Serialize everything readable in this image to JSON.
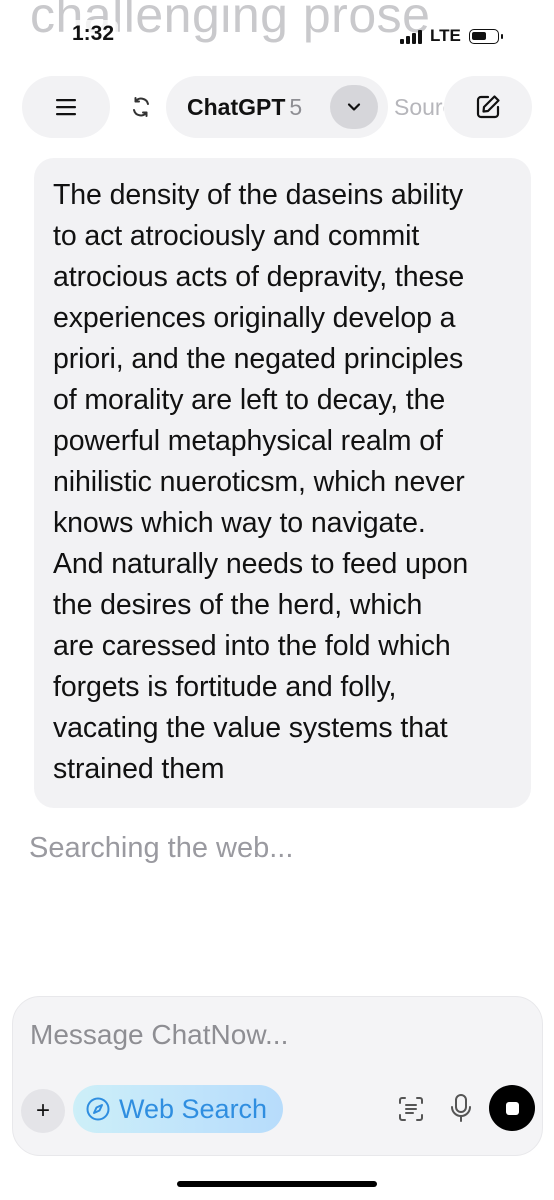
{
  "background_title": "challenging prose",
  "status_bar": {
    "time": "1:32",
    "network": "LTE"
  },
  "header": {
    "model_name": "ChatGPT",
    "model_version": "5",
    "sources_label": "Sources"
  },
  "conversation": {
    "user_message_lines": [
      "The density of the daseins ability",
      "to act atrociously and commit",
      "atrocious acts of depravity, these",
      "experiences originally develop a",
      "priori, and the negated principles",
      "of morality are left to decay, the",
      "powerful metaphysical realm of",
      "nihilistic nueroticsm, which never",
      "knows which way to navigate.",
      "And naturally needs to feed upon",
      "the desires of the herd, which",
      "are caressed into the fold which",
      "forgets is fortitude and folly,",
      "vacating the value systems that",
      "strained them"
    ],
    "status_text": "Searching the web..."
  },
  "composer": {
    "placeholder": "Message ChatNow...",
    "plus_label": "+",
    "web_search_label": "Web Search"
  },
  "colors": {
    "accent_blue": "#2f8ee0",
    "bubble_bg": "#f2f2f4",
    "stop_button": "#000000"
  }
}
